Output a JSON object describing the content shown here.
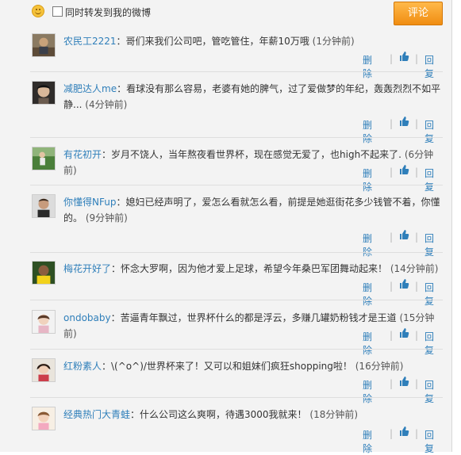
{
  "header": {
    "forward_label": "同时转发到我的微博",
    "comment_button": "评论"
  },
  "actions": {
    "delete": "删除",
    "sep": "|",
    "reply": "回复"
  },
  "comments": [
    {
      "user": "农民工2221",
      "text": "：哥们来我们公司吧，管吃管住，年薪10万哦",
      "time": "(1分钟前)"
    },
    {
      "user": "减肥达人me",
      "text": "：看球没有那么容易，老婆有她的脾气，过了爱做梦的年纪，轰轰烈烈不如平静...",
      "time": "(4分钟前)"
    },
    {
      "user": "有花初开",
      "text": "：岁月不饶人，当年熬夜看世界杯，现在感觉无爱了，也high不起来了.",
      "time": "(6分钟前)"
    },
    {
      "user": "你懂得NFup",
      "text": "：媳妇已经声明了，爱怎么看就怎么看，前提是她逛街花多少钱管不着，你懂的。",
      "time": "(9分钟前)"
    },
    {
      "user": "梅花开好了",
      "text": "：怀念大罗啊，因为他才爱上足球，希望今年桑巴军团舞动起来！",
      "time": "(14分钟前)"
    },
    {
      "user": "ondobaby",
      "text": "：苦逼青年飘过，世界杯什么的都是浮云，多赚几罐奶粉钱才是王道",
      "time": "(15分钟前)"
    },
    {
      "user": "红粉素人",
      "text": "：\\(^o^)/世界杯来了！又可以和姐妹们疯狂shopping啦！",
      "time": "(16分钟前)"
    },
    {
      "user": "经典热门大青蛙",
      "text": "：什么公司这么爽啊，待遇3000我就来！",
      "time": "(18分钟前)"
    }
  ]
}
